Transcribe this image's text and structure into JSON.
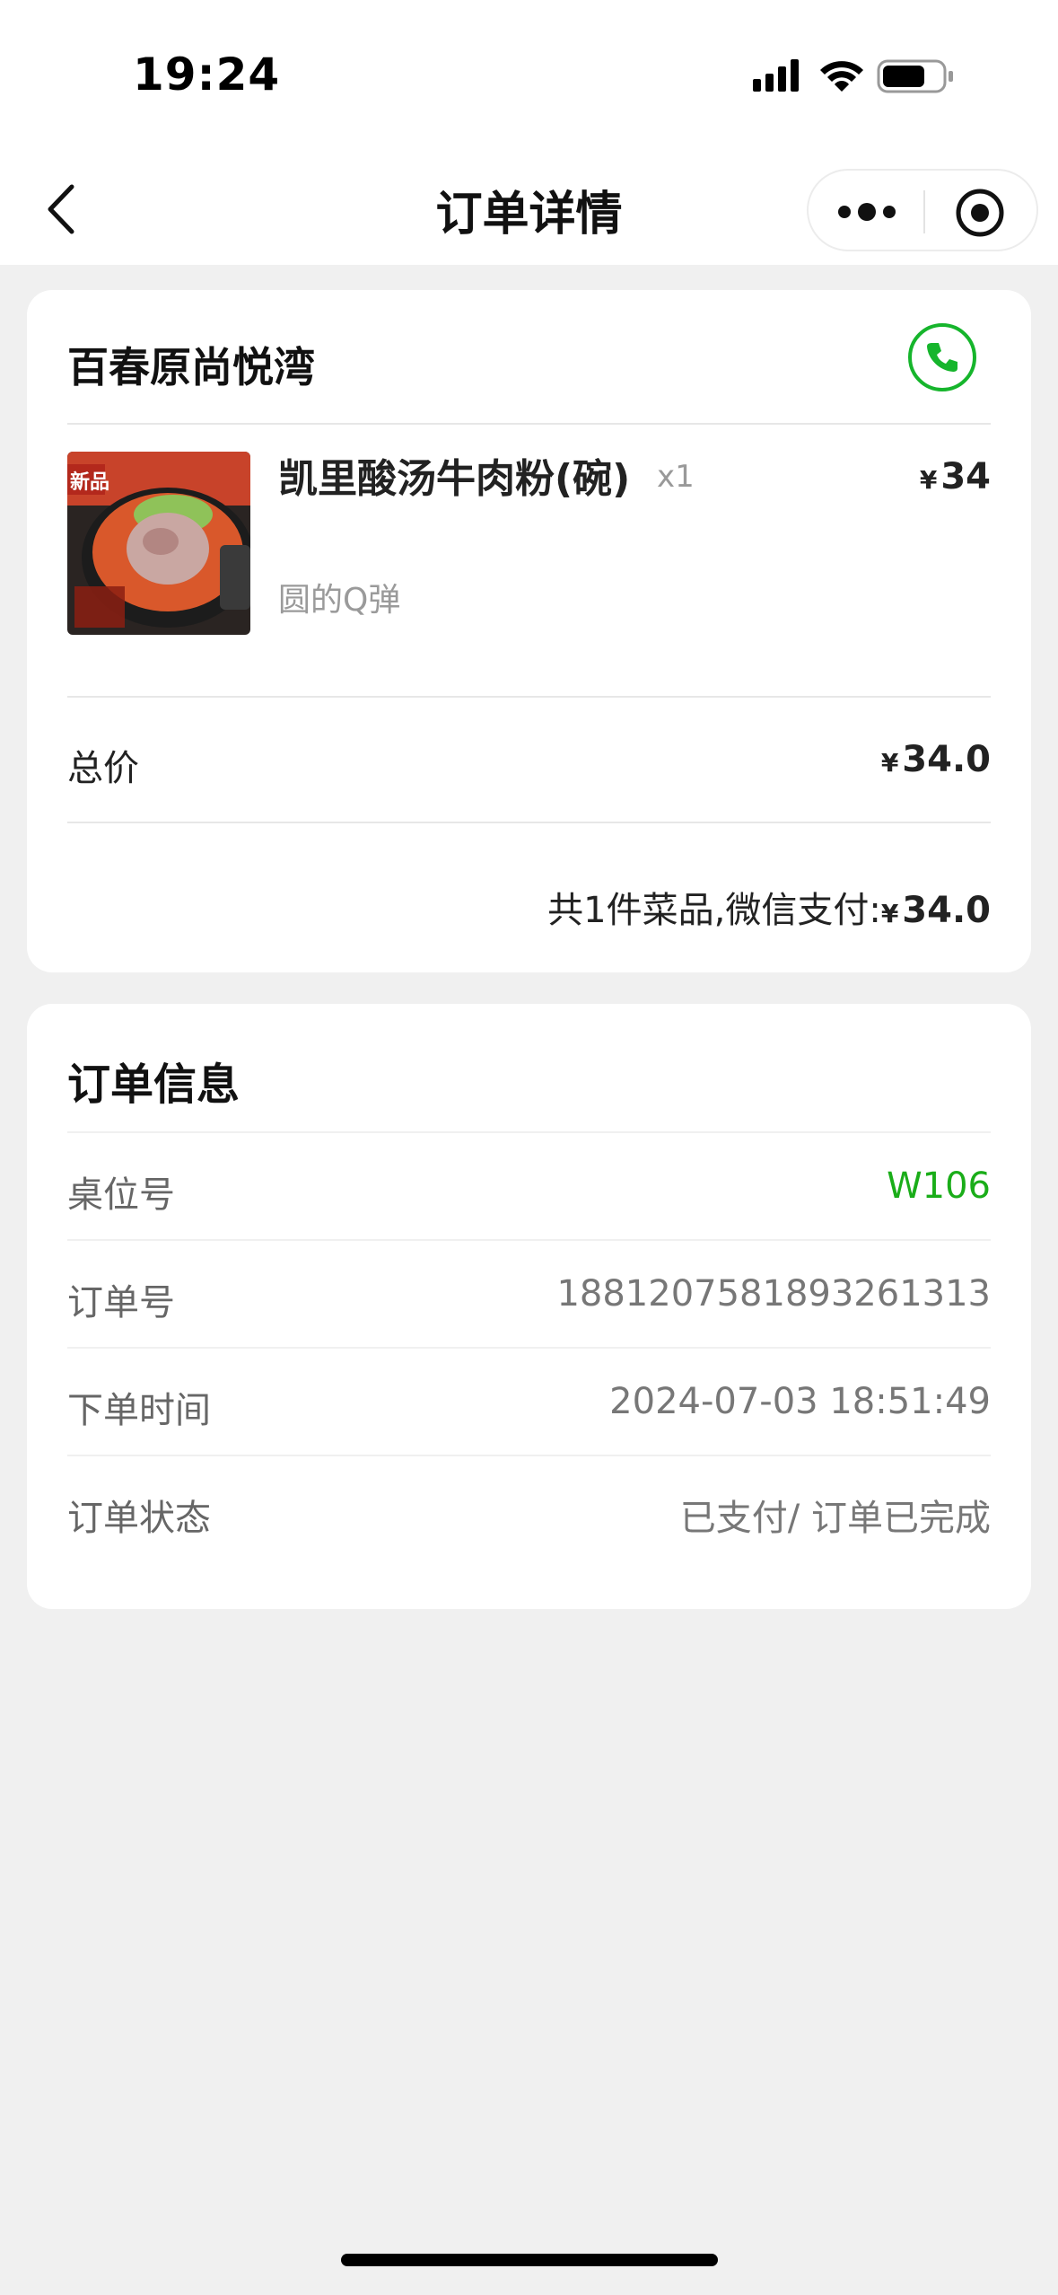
{
  "status_bar": {
    "time": "19:24"
  },
  "nav": {
    "title": "订单详情"
  },
  "shop": {
    "name": "百春原尚悦湾"
  },
  "item": {
    "name": "凯里酸汤牛肉粉(碗)",
    "spec": "圆的Q弹",
    "qty": "x1",
    "currency": "¥",
    "price": "34",
    "image_badge": "新品"
  },
  "total": {
    "label": "总价",
    "currency": "¥",
    "amount": "34.0"
  },
  "summary": {
    "text": "共1件菜品,微信支付:",
    "currency": "¥",
    "amount": "34.0"
  },
  "order_info": {
    "title": "订单信息",
    "rows": [
      {
        "label": "桌位号",
        "value": "W106"
      },
      {
        "label": "订单号",
        "value": "1881207581893261313"
      },
      {
        "label": "下单时间",
        "value": "2024-07-03 18:51:49"
      },
      {
        "label": "订单状态",
        "value": "已支付/ 订单已完成"
      }
    ]
  },
  "colors": {
    "accent_green": "#1aad19",
    "background": "#f0f0f0"
  }
}
